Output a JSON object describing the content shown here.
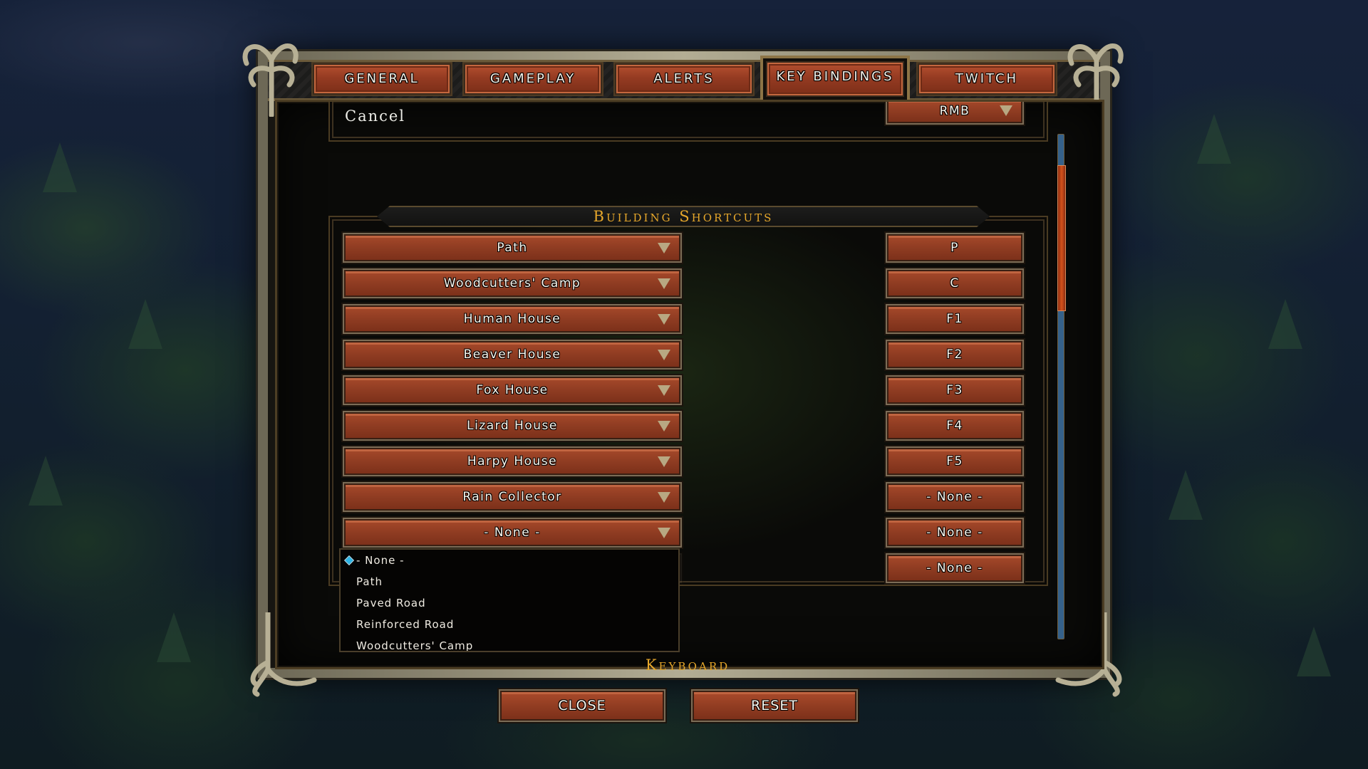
{
  "tabs": [
    {
      "label": "GENERAL",
      "active": false
    },
    {
      "label": "GAMEPLAY",
      "active": false
    },
    {
      "label": "ALERTS",
      "active": false
    },
    {
      "label": "KEY BINDINGS",
      "active": true
    },
    {
      "label": "TWITCH",
      "active": false
    }
  ],
  "cancel_row": {
    "label": "Cancel",
    "key": "RMB"
  },
  "building_shortcuts": {
    "title": "Building Shortcuts",
    "rows": [
      {
        "building": "Path",
        "key": "P"
      },
      {
        "building": "Woodcutters' Camp",
        "key": "C"
      },
      {
        "building": "Human House",
        "key": "F1"
      },
      {
        "building": "Beaver House",
        "key": "F2"
      },
      {
        "building": "Fox House",
        "key": "F3"
      },
      {
        "building": "Lizard House",
        "key": "F4"
      },
      {
        "building": "Harpy House",
        "key": "F5"
      },
      {
        "building": "Rain Collector",
        "key": "- None -"
      },
      {
        "building": "- None -",
        "key": "- None -"
      },
      {
        "building": "- None -",
        "key": "- None -"
      }
    ]
  },
  "dropdown": {
    "selected": "- None -",
    "options": [
      "- None -",
      "Path",
      "Paved Road",
      "Reinforced Road",
      "Woodcutters' Camp"
    ]
  },
  "keyboard_section": {
    "title": "Keyboard"
  },
  "scroll": {
    "position_fraction": 0.06,
    "visible_fraction": 0.29
  },
  "footer": {
    "close_label": "CLOSE",
    "reset_label": "RESET"
  },
  "colors": {
    "accent_gold": "#e6a72b",
    "button_red": "#953b22",
    "scroll_track": "#35618a",
    "scroll_thumb": "#d4521c",
    "selected_marker": "#2db5e6"
  }
}
